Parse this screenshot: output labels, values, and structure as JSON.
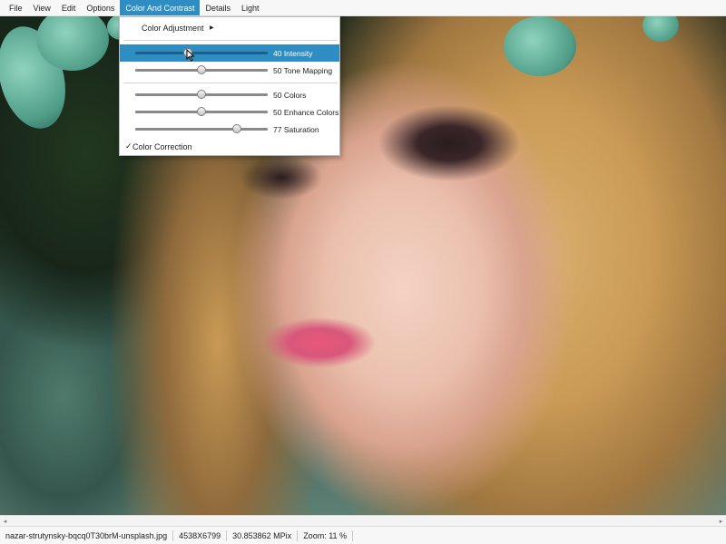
{
  "menubar": {
    "items": [
      {
        "label": "File"
      },
      {
        "label": "View"
      },
      {
        "label": "Edit"
      },
      {
        "label": "Options"
      },
      {
        "label": "Color And Contrast"
      },
      {
        "label": "Details"
      },
      {
        "label": "Light"
      }
    ],
    "active_item": "Color And Contrast",
    "accent_color": "#2e8ec3"
  },
  "dropdown": {
    "submenu": {
      "label": "Color Adjustment",
      "arrow_icon": "triangle-right-icon"
    },
    "sliders": [
      {
        "label": "40 Intensity",
        "value": 40,
        "highlighted": true
      },
      {
        "label": "50 Tone Mapping",
        "value": 50,
        "highlighted": false
      },
      {
        "label": "50 Colors",
        "value": 50,
        "highlighted": false
      },
      {
        "label": "50 Enhance Colors",
        "value": 50,
        "highlighted": false
      },
      {
        "label": "77 Saturation",
        "value": 77,
        "highlighted": false
      }
    ],
    "check_item": {
      "label": "Color Correction",
      "checked": true,
      "mark": "✓"
    }
  },
  "scrollbar": {
    "left_arrow": "◂",
    "right_arrow": "▸"
  },
  "statusbar": {
    "filename": "nazar-strutynsky-bqcq0T30brM-unsplash.jpg",
    "dimensions": "4538X6799",
    "megapixels": "30.853862 MPix",
    "zoom": "Zoom: 11 %"
  }
}
